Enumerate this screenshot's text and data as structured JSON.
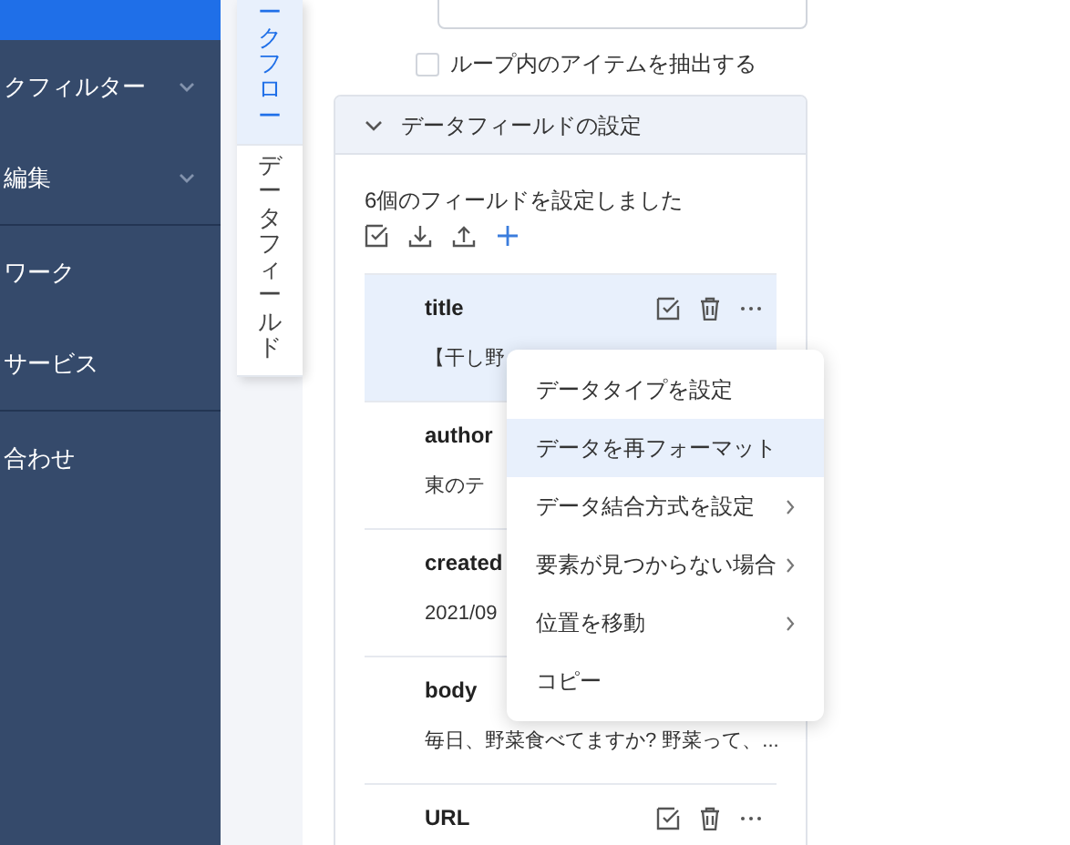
{
  "sidebar": {
    "items": [
      {
        "selected": true,
        "expandable": false,
        "divider_after": false
      },
      {
        "label": "クフィルター",
        "selected": false,
        "expandable": true,
        "divider_after": false
      },
      {
        "label": "編集",
        "selected": false,
        "expandable": true,
        "divider_after": true
      },
      {
        "label": "ワーク",
        "selected": false,
        "expandable": false,
        "divider_after": false
      },
      {
        "label": "サービス",
        "selected": false,
        "expandable": false,
        "divider_after": true
      },
      {
        "label": "合わせ",
        "selected": false,
        "expandable": false,
        "divider_after": false
      }
    ]
  },
  "vertical_tabs": [
    {
      "label": "ークフロー",
      "selected": true
    },
    {
      "label": "データフィールド",
      "selected": false
    }
  ],
  "extract_loop_items": {
    "label": "ループ内のアイテムを抽出する",
    "checked": false
  },
  "data_field_section": {
    "title": "データフィールドの設定",
    "expanded": true,
    "summary": "6個のフィールドを設定しました",
    "fields": [
      {
        "name": "title",
        "value": "【干し野",
        "selected": true,
        "show_actions": true
      },
      {
        "name": "author",
        "value": "東のテ",
        "selected": false
      },
      {
        "name": "created",
        "value": "2021/09",
        "selected": false
      },
      {
        "name": "body",
        "value": "毎日、野菜食べてますか? 野菜って、...",
        "selected": false
      },
      {
        "name": "URL",
        "selected": false,
        "show_actions": true
      }
    ]
  },
  "context_menu": {
    "items": [
      {
        "label": "データタイプを設定",
        "selected": false,
        "submenu": false
      },
      {
        "label": "データを再フォーマット",
        "selected": true,
        "submenu": false
      },
      {
        "label": "データ結合方式を設定",
        "selected": false,
        "submenu": true
      },
      {
        "label": "要素が見つからない場合",
        "selected": false,
        "submenu": true
      },
      {
        "label": "位置を移動",
        "selected": false,
        "submenu": true
      },
      {
        "label": "コピー",
        "selected": false,
        "submenu": false
      }
    ]
  }
}
